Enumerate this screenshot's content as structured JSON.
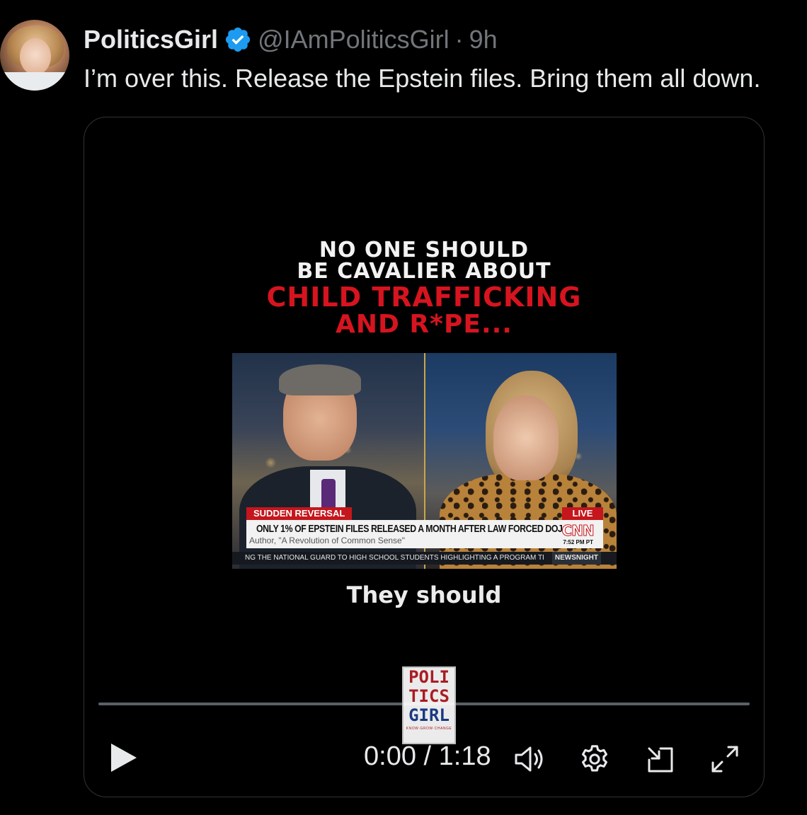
{
  "tweet": {
    "display_name": "PoliticsGirl",
    "handle": "@IAmPoliticsGirl",
    "separator": "·",
    "time": "9h",
    "text": "I’m over this. Release the Epstein files. Bring them all down."
  },
  "video": {
    "overlay_lines": [
      "NO ONE SHOULD",
      "BE CAVALIER ABOUT",
      "CHILD TRAFFICKING",
      "AND R*PE..."
    ],
    "clip": {
      "topic_tag": "SUDDEN REVERSAL",
      "live_tag": "LIVE",
      "headline": "ONLY 1% OF EPSTEIN FILES RELEASED A MONTH AFTER LAW FORCED DOJ",
      "subhead": "Author, \"A Revolution of Common Sense\"",
      "network": "CNN",
      "network_time": "7:52 PM PT",
      "ticker": "NG THE NATIONAL GUARD TO HIGH SCHOOL STUDENTS HIGHLIGHTING A PROGRAM TI",
      "show_name": "NEWSNIGHT"
    },
    "caption": "They should",
    "watermark": {
      "lines": [
        "POLI",
        "TICS",
        "GIRL"
      ],
      "tagline": "KNOW·GROW·CHANGE"
    },
    "player": {
      "current_time": "0:00",
      "duration": "1:18",
      "time_separator": " / ",
      "progress": 0.0
    }
  },
  "icons": {
    "verified": "verified-badge-icon",
    "play": "play-icon",
    "volume": "volume-icon",
    "settings": "gear-icon",
    "pip": "picture-in-picture-icon",
    "fullscreen": "fullscreen-icon"
  },
  "colors": {
    "background": "#000000",
    "text_primary": "#e7e9ea",
    "text_secondary": "#71767b",
    "verified_blue": "#1d9bf0",
    "overlay_red": "#d6141f",
    "cnn_red": "#c4161c"
  }
}
